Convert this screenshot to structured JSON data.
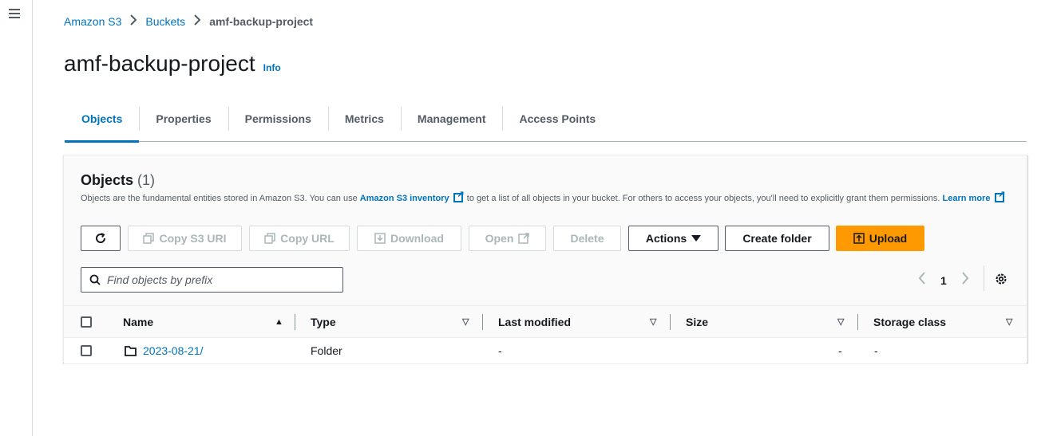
{
  "breadcrumb": {
    "root": "Amazon S3",
    "buckets": "Buckets",
    "current": "amf-backup-project"
  },
  "page": {
    "title": "amf-backup-project",
    "info": "Info"
  },
  "tabs": [
    {
      "label": "Objects",
      "active": true
    },
    {
      "label": "Properties"
    },
    {
      "label": "Permissions"
    },
    {
      "label": "Metrics"
    },
    {
      "label": "Management"
    },
    {
      "label": "Access Points"
    }
  ],
  "objects_panel": {
    "title": "Objects",
    "count": "(1)",
    "desc_part1": "Objects are the fundamental entities stored in Amazon S3. You can use ",
    "inventory_link": "Amazon S3 inventory",
    "desc_part2": " to get a list of all objects in your bucket. For others to access your objects, you'll need to explicitly grant them permissions. ",
    "learn_more": "Learn more"
  },
  "toolbar": {
    "copy_s3_uri": "Copy S3 URI",
    "copy_url": "Copy URL",
    "download": "Download",
    "open": "Open",
    "delete": "Delete",
    "actions": "Actions",
    "create_folder": "Create folder",
    "upload": "Upload"
  },
  "search": {
    "placeholder": "Find objects by prefix"
  },
  "pagination": {
    "current_page": "1"
  },
  "table": {
    "columns": [
      "Name",
      "Type",
      "Last modified",
      "Size",
      "Storage class"
    ],
    "rows": [
      {
        "name": "2023-08-21/",
        "type": "Folder",
        "last_modified": "-",
        "size": "-",
        "storage_class": "-"
      }
    ]
  },
  "colors": {
    "link": "#0073bb",
    "primary": "#ff9900",
    "text": "#16191f",
    "muted": "#545b64"
  }
}
